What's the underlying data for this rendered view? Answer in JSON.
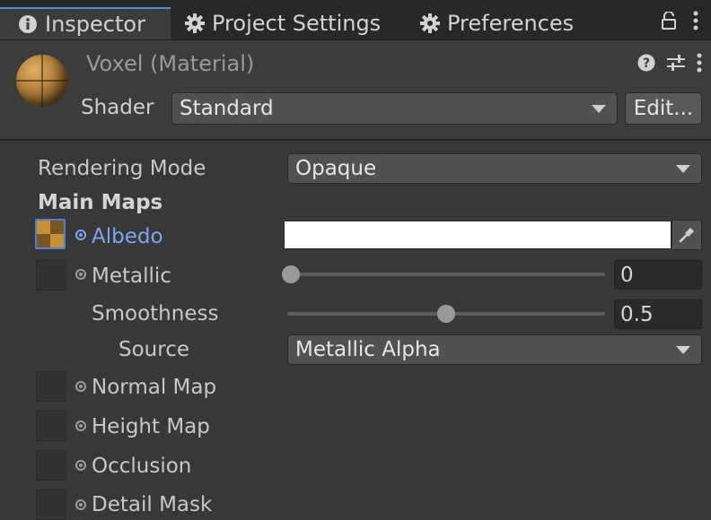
{
  "tabs": [
    {
      "label": "Inspector",
      "icon": "info-icon"
    },
    {
      "label": "Project Settings",
      "icon": "gear-icon"
    },
    {
      "label": "Preferences",
      "icon": "gear-icon"
    }
  ],
  "header": {
    "title": "Voxel (Material)",
    "shader_label": "Shader",
    "shader_value": "Standard",
    "edit_label": "Edit..."
  },
  "props": {
    "rendering_mode_label": "Rendering Mode",
    "rendering_mode_value": "Opaque",
    "main_maps_label": "Main Maps",
    "albedo_label": "Albedo",
    "albedo_color": "#ffffff",
    "metallic_label": "Metallic",
    "metallic_value": "0",
    "metallic_fraction": 0,
    "smoothness_label": "Smoothness",
    "smoothness_value": "0.5",
    "smoothness_fraction": 0.5,
    "source_label": "Source",
    "source_value": "Metallic Alpha",
    "normal_map_label": "Normal Map",
    "height_map_label": "Height Map",
    "occlusion_label": "Occlusion",
    "detail_mask_label": "Detail Mask"
  },
  "colors": {
    "accent": "#4d8fd8",
    "albedo_label_color": "#7ba6f0",
    "background": "#383838"
  }
}
